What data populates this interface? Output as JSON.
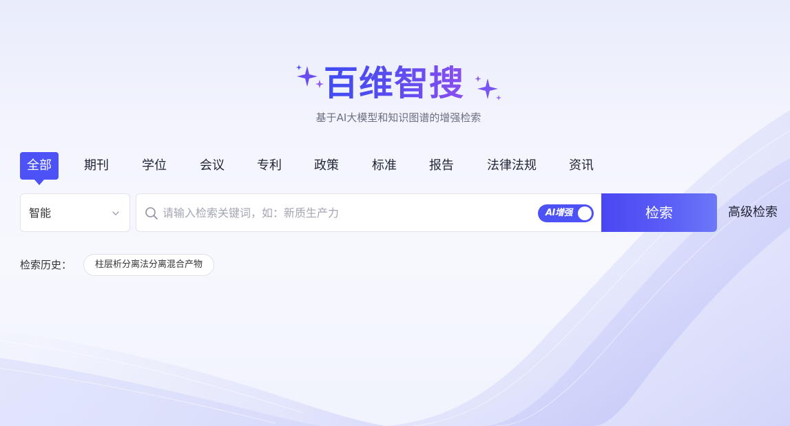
{
  "logo": {
    "text": "百维智搜"
  },
  "subtitle": "基于AI大模型和知识图谱的增强检索",
  "tabs": [
    {
      "label": "全部",
      "active": true
    },
    {
      "label": "期刊",
      "active": false
    },
    {
      "label": "学位",
      "active": false
    },
    {
      "label": "会议",
      "active": false
    },
    {
      "label": "专利",
      "active": false
    },
    {
      "label": "政策",
      "active": false
    },
    {
      "label": "标准",
      "active": false
    },
    {
      "label": "报告",
      "active": false
    },
    {
      "label": "法律法规",
      "active": false
    },
    {
      "label": "资讯",
      "active": false
    }
  ],
  "search": {
    "mode_selected": "智能",
    "placeholder": "请输入检索关键词，如：新质生产力",
    "value": "",
    "ai_toggle_label": "AI增强",
    "ai_toggle_on": true,
    "submit_label": "检索",
    "advanced_label": "高级检索"
  },
  "history": {
    "label": "检索历史：",
    "items": [
      "柱层析分离法分离混合产物"
    ]
  },
  "colors": {
    "accent": "#4c52f5",
    "logo_gradient_start": "#3e4cf2",
    "logo_gradient_end": "#8a4ef0",
    "text_primary": "#1f2333",
    "text_secondary": "#6b6f80"
  },
  "icons": [
    "sparkle-icon",
    "chevron-down-icon",
    "search-icon"
  ]
}
